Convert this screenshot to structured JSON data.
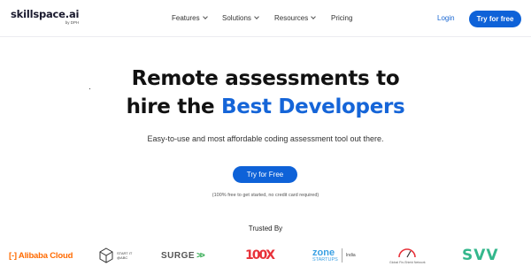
{
  "nav": {
    "logo": "skillspace.ai",
    "logo_sub": "by DPH",
    "menu": [
      {
        "label": "Features"
      },
      {
        "label": "Solutions"
      },
      {
        "label": "Resources"
      },
      {
        "label": "Pricing"
      }
    ],
    "login": "Login",
    "cta": "Try for free"
  },
  "hero": {
    "line1": "Remote assessments to",
    "line2_prefix": "hire the ",
    "line2_accent": "Best Developers",
    "subtitle": "Easy-to-use and most affordable coding assessment tool out there.",
    "cta": "Try for Free",
    "note": "(100% free to get started, no credit card required)"
  },
  "trusted": {
    "label": "Trusted By",
    "logos": [
      {
        "name": "Alibaba Cloud",
        "text": "Alibaba Cloud",
        "icon": "alibaba-icon",
        "color": "#ff6a00"
      },
      {
        "name": "Start IT @ ABC",
        "text": "START IT @ABC",
        "icon": "cube-icon"
      },
      {
        "name": "SURGE",
        "text": "SURGE",
        "arrows": ">>",
        "color": "#2aa84a"
      },
      {
        "name": "100X",
        "text": "100X",
        "color": "#e8323a"
      },
      {
        "name": "Zone Startups India",
        "big": "zone",
        "small": "STARTUPS",
        "region": "India",
        "color": "#3aa0e3"
      },
      {
        "name": "Global Startup Network",
        "text": "Global Fin-Shield Network",
        "icon": "gauge-icon"
      },
      {
        "name": "SVV",
        "text": "SVV",
        "color": "#34b78c"
      }
    ]
  },
  "colors": {
    "accent": "#1565d8",
    "button": "#0e62d8"
  }
}
